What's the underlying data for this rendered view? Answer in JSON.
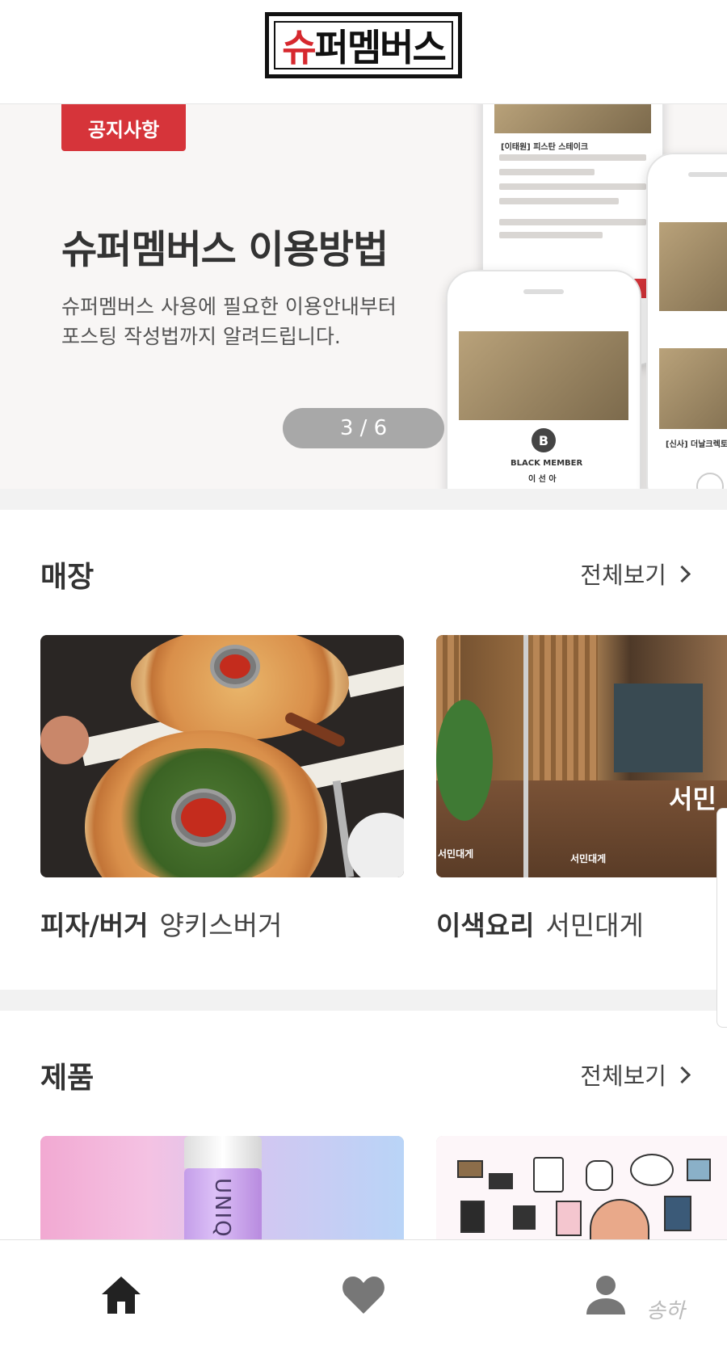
{
  "header": {
    "logo_text": "슈퍼멤버스",
    "logo_first": "슈",
    "logo_rest": "퍼멤버스"
  },
  "banner": {
    "badge": "공지사항",
    "title": "슈퍼멤버스 이용방법",
    "subtitle_line1": "슈퍼멤버스 사용에 필요한 이용안내부터",
    "subtitle_line2": "포스팅 작성법까지 알려드립니다.",
    "pager": "3 / 6",
    "phone_back_title": "[이태원] 피스탄 스테이크",
    "phone_front_member": "BLACK MEMBER",
    "phone_front_name": "이 선 아",
    "phone_front_badge": "B",
    "phone_right_title": "[신사] 더날크렉토리"
  },
  "stores": {
    "title": "매장",
    "view_all": "전체보기",
    "items": [
      {
        "category": "피자/버거",
        "name": "양키스버거"
      },
      {
        "category": "이색요리",
        "name": "서민대게",
        "sign": "서민",
        "sign_small": "서민대게"
      }
    ]
  },
  "products": {
    "title": "제품",
    "view_all": "전체보기",
    "bottle_text": "UNIQ"
  },
  "nav": {
    "home": "home-icon",
    "likes": "heart-icon",
    "profile": "person-icon"
  },
  "watermark": "송하",
  "colors": {
    "accent": "#d6343a",
    "nav_active": "#222222",
    "nav_inactive": "#777777"
  }
}
